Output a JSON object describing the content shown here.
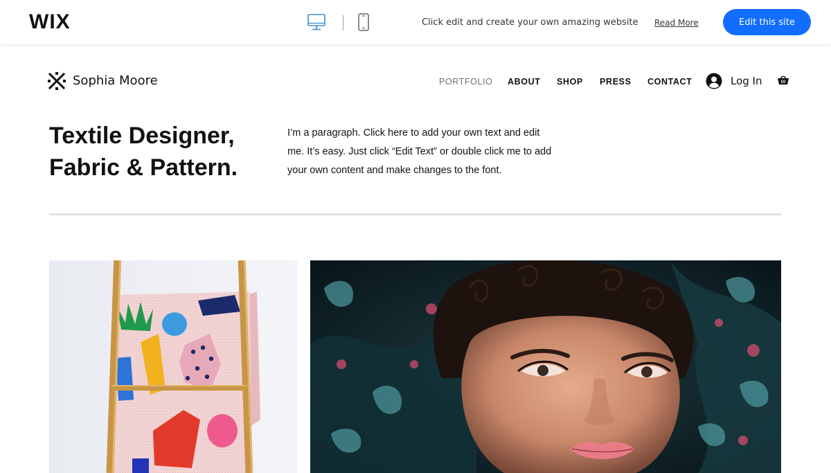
{
  "wix_bar": {
    "logo": "WIX",
    "tagline": "Click edit and create your own amazing website",
    "read_more": "Read More",
    "edit_button": "Edit this site",
    "accent_color": "#116dff",
    "device_icons": [
      "desktop-icon",
      "mobile-icon"
    ]
  },
  "site": {
    "name": "Sophia Moore",
    "nav": [
      "PORTFOLIO",
      "ABOUT",
      "SHOP",
      "PRESS",
      "CONTACT"
    ],
    "active_nav": "PORTFOLIO",
    "login_label": "Log In"
  },
  "hero": {
    "title_line1": "Textile Designer,",
    "title_line2": "Fabric & Pattern.",
    "paragraph_line1": "I’m a paragraph. Click here to add your own text and edit",
    "paragraph_line2": "me. It’s easy. Just click “Edit Text” or double click me to add",
    "paragraph_line3": "your own content and make changes to the font."
  },
  "gallery": {
    "images": [
      "textile-blanket-on-ladder-image",
      "woman-in-floral-fabric-hood-image"
    ]
  }
}
